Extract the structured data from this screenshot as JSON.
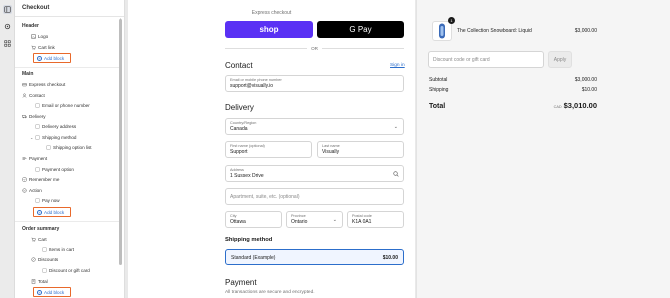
{
  "sidebar": {
    "title": "Checkout",
    "sections": {
      "header": "Header",
      "main": "Main",
      "order_summary": "Order summary"
    },
    "items": {
      "logo": "Logo",
      "cart_link": "Cart link",
      "express_checkout": "Express checkout",
      "contact": "Contact",
      "email_or_phone": "Email or phone number",
      "delivery": "Delivery",
      "delivery_address": "Delivery address",
      "shipping_method": "Shipping method",
      "shipping_option_list": "Shipping option list",
      "payment": "Payment",
      "payment_option": "Payment option",
      "remember_me": "Remember me",
      "action": "Action",
      "pay_now": "Pay now",
      "cart": "Cart",
      "items_in_cart": "Items in cart",
      "discounts": "Discounts",
      "discount_or_gift_card": "Discount or gift card",
      "total": "Total"
    },
    "add_block_label": "Add block"
  },
  "checkout": {
    "express_label": "Express checkout",
    "shop_label": "shop",
    "gpay_label": "G Pay",
    "or_label": "OR",
    "contact_heading": "Contact",
    "sign_in": "Sign in",
    "email_label": "Email or mobile phone number",
    "email_value": "support@visually.io",
    "delivery_heading": "Delivery",
    "country_label": "Country/Region",
    "country_value": "Canada",
    "first_name_label": "First name (optional)",
    "first_name_value": "Support",
    "last_name_label": "Last name",
    "last_name_value": "Visually",
    "address_label": "Address",
    "address_value": "1 Sussex Drive",
    "apartment_placeholder": "Apartment, suite, etc. (optional)",
    "city_label": "City",
    "city_value": "Ottawa",
    "province_label": "Province",
    "province_value": "Ontario",
    "postal_label": "Postal code",
    "postal_value": "K1A 0A1",
    "shipping_heading": "Shipping method",
    "shipping_option_name": "Standard (Example)",
    "shipping_option_price": "$10.00",
    "payment_heading": "Payment",
    "payment_note": "All transactions are secure and encrypted."
  },
  "summary": {
    "product_name": "The Collection Snowboard: Liquid",
    "product_qty": "1",
    "product_price": "$3,000.00",
    "discount_placeholder": "Discount code or gift card",
    "apply_label": "Apply",
    "subtotal_label": "Subtotal",
    "subtotal_value": "$3,000.00",
    "shipping_label": "Shipping",
    "shipping_value": "$10.00",
    "total_label": "Total",
    "currency": "CAD",
    "total_value": "$3,010.00"
  },
  "colors": {
    "accent_orange": "#e8692b",
    "link_blue": "#2c6ecb",
    "shop_purple": "#5a31f4"
  }
}
